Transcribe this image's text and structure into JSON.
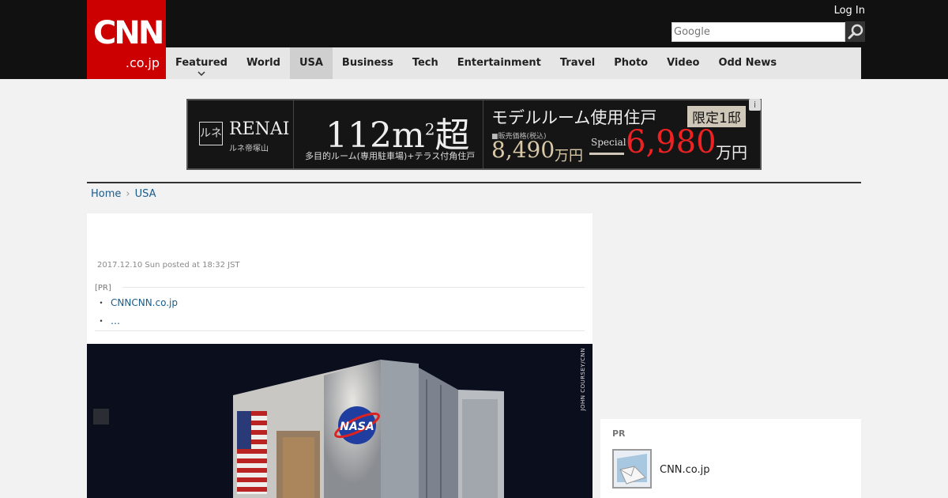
{
  "header": {
    "logo_text": "CNN",
    "logo_domain": ".co.jp",
    "login_label": "Log In",
    "search_placeholder": "Google",
    "nav": [
      {
        "label": "Featured"
      },
      {
        "label": "World"
      },
      {
        "label": "USA",
        "active": true
      },
      {
        "label": "Business"
      },
      {
        "label": "Tech"
      },
      {
        "label": "Entertainment"
      },
      {
        "label": "Travel"
      },
      {
        "label": "Photo"
      },
      {
        "label": "Video"
      },
      {
        "label": "Odd News"
      }
    ]
  },
  "ad": {
    "brand": "RENAI",
    "brand_mark": "ルネ",
    "brand_sub": "ルネ帝塚山",
    "area_number": "112m",
    "area_sup": "2",
    "area_suffix": "超",
    "area_sub": "多目的ルーム(専用駐車場)+テラス付角住戸",
    "model_title": "モデルルーム使用住戸",
    "limited": "限定1邸",
    "price_label": "■販売価格(税込)",
    "price_old": "8,490",
    "price_unit": "万円",
    "special": "Special",
    "price_new": "6,980",
    "price_new_unit": "万円",
    "info_icon": "i"
  },
  "breadcrumb": {
    "home": "Home",
    "current": "USA"
  },
  "article": {
    "date": "2017.12.10 Sun posted at 18:32 JST",
    "pr_label": "[PR]",
    "pr_items": [
      "CNNCNN.co.jp",
      "…"
    ],
    "photo_credit": "JOHN COURSEY/CNN"
  },
  "sidebar": {
    "pr_label": "PR",
    "pr_item": "CNN.co.jp"
  },
  "colors": {
    "brand_red": "#cc0000",
    "link_blue": "#1a5c8a",
    "topbar": "#111111"
  }
}
